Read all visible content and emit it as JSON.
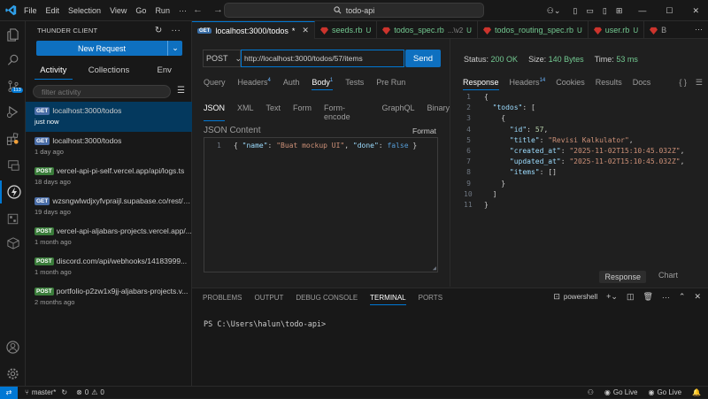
{
  "titlebar": {
    "menus": [
      "File",
      "Edit",
      "Selection",
      "View",
      "Go",
      "Run"
    ],
    "search_text": "todo-api"
  },
  "activity_bar": {
    "icons": [
      "explorer-icon",
      "search-icon",
      "source-control-icon",
      "run-debug-icon",
      "extensions-icon",
      "remote-explorer-icon",
      "thunder-client-icon",
      "testing-icon",
      "database-icon",
      "accounts-icon",
      "settings-icon"
    ],
    "scm_badge": "113"
  },
  "sidebar": {
    "title": "THUNDER CLIENT",
    "new_request": "New Request",
    "tabs": [
      "Activity",
      "Collections",
      "Env"
    ],
    "filter_placeholder": "filter activity",
    "items": [
      {
        "method": "GET",
        "url": "localhost:3000/todos",
        "time": "just now"
      },
      {
        "method": "GET",
        "url": "localhost:3000/todos",
        "time": "1 day ago"
      },
      {
        "method": "POST",
        "url": "vercel-api-pi-self.vercel.app/api/logs.ts",
        "time": "18 days ago"
      },
      {
        "method": "GET",
        "url": "wzsngwlwdjxyfvpraijl.supabase.co/rest/v...",
        "time": "19 days ago"
      },
      {
        "method": "POST",
        "url": "vercel-api-aljabars-projects.vercel.app/...",
        "time": "1 month ago"
      },
      {
        "method": "POST",
        "url": "discord.com/api/webhooks/14183999...",
        "time": "1 month ago"
      },
      {
        "method": "POST",
        "url": "portfolio-p2zw1x9jj-aljabars-projects.v...",
        "time": "2 months ago"
      }
    ]
  },
  "editor_tabs": [
    {
      "label": "localhost:3000/todos",
      "suffix": "*",
      "kind": "get",
      "active": true
    },
    {
      "label": "seeds.rb",
      "suffix": "U",
      "kind": "ruby"
    },
    {
      "label": "todos_spec.rb",
      "path": "...\\v2",
      "suffix": "U",
      "kind": "ruby"
    },
    {
      "label": "todos_routing_spec.rb",
      "suffix": "U",
      "kind": "ruby"
    },
    {
      "label": "user.rb",
      "suffix": "U",
      "kind": "ruby"
    },
    {
      "label": "B",
      "suffix": "",
      "kind": "ruby"
    }
  ],
  "request": {
    "method": "POST",
    "url": "http://localhost:3000/todos/57/items",
    "send": "Send",
    "tabs": [
      "Query",
      "Headers",
      "Auth",
      "Body",
      "Tests",
      "Pre Run"
    ],
    "headers_count": "4",
    "body_count": "1",
    "body_tabs": [
      "JSON",
      "XML",
      "Text",
      "Form",
      "Form-encode",
      "GraphQL",
      "Binary"
    ],
    "json_label": "JSON Content",
    "format": "Format",
    "line_number": "1"
  },
  "response": {
    "status_label": "Status:",
    "status": "200 OK",
    "size_label": "Size:",
    "size": "140 Bytes",
    "time_label": "Time:",
    "time": "53 ms",
    "tabs": [
      "Response",
      "Headers",
      "Cookies",
      "Results",
      "Docs"
    ],
    "headers_count": "14",
    "lines": [
      "1",
      "2",
      "3",
      "4",
      "5",
      "6",
      "7",
      "8",
      "9",
      "10",
      "11"
    ],
    "view_buttons": [
      "Response",
      "Chart"
    ]
  },
  "panel": {
    "tabs": [
      "PROBLEMS",
      "OUTPUT",
      "DEBUG CONSOLE",
      "TERMINAL",
      "PORTS"
    ],
    "shell": "powershell",
    "prompt": "PS C:\\Users\\halun\\todo-api>"
  },
  "statusbar": {
    "branch": "master*",
    "errors": "0",
    "warnings": "0",
    "golive1": "Go Live",
    "golive2": "Go Live"
  }
}
